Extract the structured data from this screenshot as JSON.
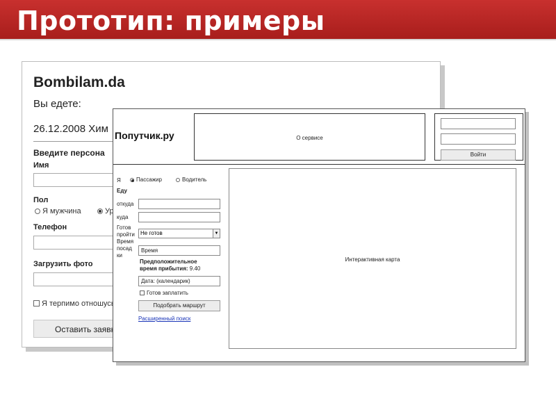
{
  "slide": {
    "title": "Прототип: примеры"
  },
  "back_window": {
    "logo": "Bombilam.da",
    "going_label": "Вы едете:",
    "date_text": "26.12.2008 Хим",
    "personal_heading": "Введите персона",
    "name_label": "Имя",
    "gender_label": "Пол",
    "gender_male": "Я мужчина",
    "gender_other": "Ур",
    "phone_label": "Телефон",
    "photo_label": "Загрузить фото",
    "tolerance_check": "Я терпимо отношусь",
    "submit_button": "Оставить заявку"
  },
  "front_window": {
    "logo": "Попутчик.ру",
    "about_box": "О сервисе",
    "login_button": "Войти",
    "role_label": "Я",
    "role_passenger": "Пассажир",
    "role_driver": "Водитель",
    "going_label": "Еду",
    "from_label": "откуда",
    "to_label": "куда",
    "ready_label_1": "Готов",
    "ready_label_2": "пройти",
    "ready_select_value": "Не готов",
    "time_label_1": "Время",
    "time_label_2": "посад",
    "time_label_3": "ки",
    "time_input": "Время",
    "eta_label_1": "Предположительное",
    "eta_label_2": "время прибытия:",
    "eta_value": "9.40",
    "date_input": "Дата:   (календарик)",
    "pay_check": "Готов заплатить",
    "route_button": "Подобрать маршрут",
    "advanced_link": "Расширенный поиск",
    "map_placeholder": "Интерактивная карта"
  },
  "colors": {
    "banner": "#b82422",
    "link": "#1a35b8"
  }
}
